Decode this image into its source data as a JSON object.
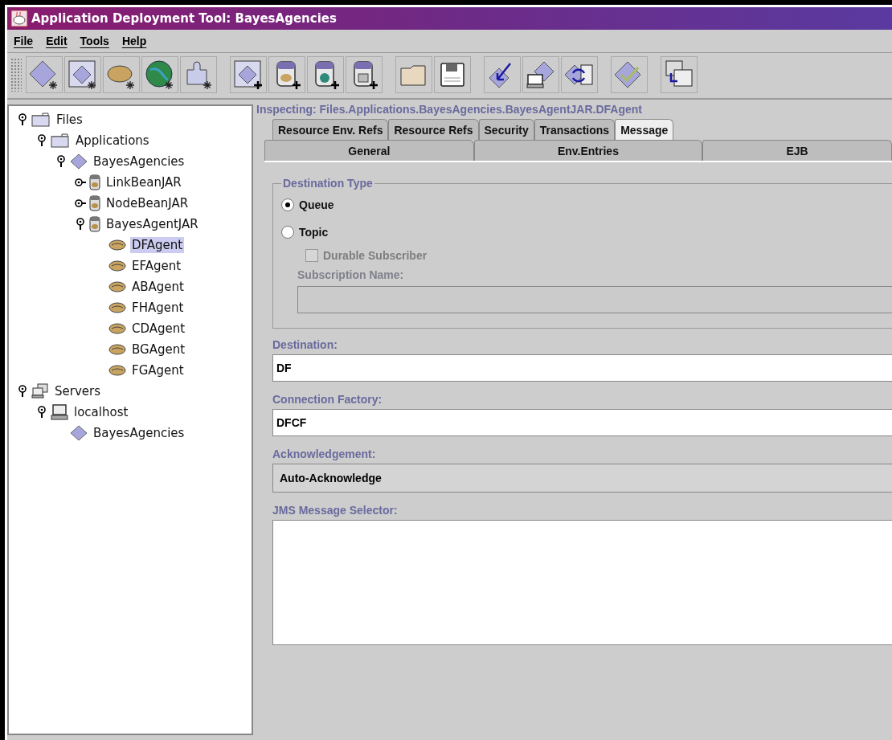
{
  "window": {
    "title": "Application Deployment Tool: BayesAgencies"
  },
  "menu": [
    {
      "label": "File"
    },
    {
      "label": "Edit"
    },
    {
      "label": "Tools"
    },
    {
      "label": "Help"
    }
  ],
  "tree": [
    {
      "label": "Files",
      "kind": "folder",
      "expanded": true,
      "selected": false,
      "children": [
        {
          "label": "Applications",
          "kind": "folder",
          "expanded": true,
          "selected": false,
          "children": [
            {
              "label": "BayesAgencies",
              "kind": "app",
              "expanded": true,
              "selected": false,
              "children": [
                {
                  "label": "LinkBeanJAR",
                  "kind": "jar",
                  "expanded": false,
                  "selected": false
                },
                {
                  "label": "NodeBeanJAR",
                  "kind": "jar",
                  "expanded": false,
                  "selected": false
                },
                {
                  "label": "BayesAgentJAR",
                  "kind": "jar",
                  "expanded": true,
                  "selected": false,
                  "children": [
                    {
                      "label": "DFAgent",
                      "kind": "bean",
                      "selected": true
                    },
                    {
                      "label": "EFAgent",
                      "kind": "bean",
                      "selected": false
                    },
                    {
                      "label": "ABAgent",
                      "kind": "bean",
                      "selected": false
                    },
                    {
                      "label": "FHAgent",
                      "kind": "bean",
                      "selected": false
                    },
                    {
                      "label": "CDAgent",
                      "kind": "bean",
                      "selected": false
                    },
                    {
                      "label": "BGAgent",
                      "kind": "bean",
                      "selected": false
                    },
                    {
                      "label": "FGAgent",
                      "kind": "bean",
                      "selected": false
                    }
                  ]
                }
              ]
            }
          ]
        }
      ]
    },
    {
      "label": "Servers",
      "kind": "servers",
      "expanded": true,
      "selected": false,
      "children": [
        {
          "label": "localhost",
          "kind": "computer",
          "expanded": true,
          "selected": false,
          "children": [
            {
              "label": "BayesAgencies",
              "kind": "app",
              "selected": false
            }
          ]
        }
      ]
    }
  ],
  "inspecting": "Inspecting: Files.Applications.BayesAgencies.BayesAgentJAR.DFAgent",
  "tab_rows": [
    [
      {
        "label": "Resource Env. Refs",
        "selected": false
      },
      {
        "label": "Resource Refs",
        "selected": false
      },
      {
        "label": "Security",
        "selected": false
      },
      {
        "label": "Transactions",
        "selected": false
      },
      {
        "label": "Message",
        "selected": true
      }
    ],
    [
      {
        "label": "General",
        "selected": false
      },
      {
        "label": "Env.Entries",
        "selected": false
      },
      {
        "label": "EJB",
        "selected": false
      }
    ]
  ],
  "destination_type": {
    "title": "Destination Type",
    "options": [
      {
        "label": "Queue",
        "selected": true
      },
      {
        "label": "Topic",
        "selected": false
      }
    ],
    "durable": {
      "label": "Durable Subscriber",
      "checked": false,
      "disabled": true
    },
    "subscription": {
      "label": "Subscription Name:",
      "disabled": true
    }
  },
  "fields": [
    {
      "kind": "text",
      "label": "Destination:",
      "value": "DF"
    },
    {
      "kind": "text",
      "label": "Connection Factory:",
      "value": "DFCF"
    },
    {
      "kind": "select",
      "label": "Acknowledgement:",
      "value": "Auto-Acknowledge"
    },
    {
      "kind": "area",
      "label": "JMS Message Selector:"
    }
  ]
}
